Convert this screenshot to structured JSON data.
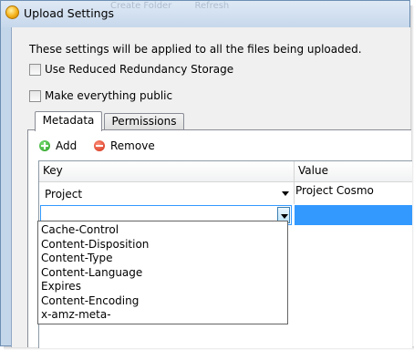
{
  "window": {
    "title": "Upload Settings",
    "background_toolbar": [
      "Create Folder",
      "Refresh"
    ]
  },
  "dialog": {
    "message": "These settings will be applied to all the files being uploaded.",
    "checkboxes": [
      {
        "label": "Use Reduced Redundancy Storage",
        "checked": false
      },
      {
        "label": "Make everything public",
        "checked": false
      }
    ],
    "tabs": [
      {
        "label": "Metadata",
        "active": true
      },
      {
        "label": "Permissions",
        "active": false
      }
    ],
    "toolbar": {
      "add_label": "Add",
      "remove_label": "Remove"
    },
    "grid": {
      "columns": [
        "Key",
        "Value"
      ],
      "rows": [
        {
          "key": "Project",
          "value": "Project Cosmo"
        },
        {
          "key": "",
          "value": ""
        }
      ]
    },
    "dropdown_options": [
      "Cache-Control",
      "Content-Disposition",
      "Content-Type",
      "Content-Language",
      "Expires",
      "Content-Encoding",
      "x-amz-meta-"
    ]
  },
  "colors": {
    "selection": "#3399ff",
    "window_frame": "#c4d6ea"
  }
}
